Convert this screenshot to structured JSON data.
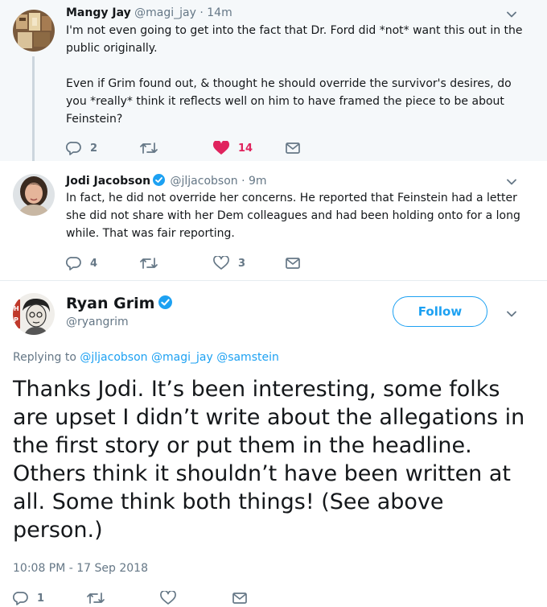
{
  "reply1": {
    "name": "Mangy Jay",
    "handle": "@magi_jay",
    "time": "· 14m",
    "paragraphs": [
      "I'm not even going to get into the fact that Dr. Ford did *not* want this out in the public originally.",
      "Even if Grim found out, & thought he should override the survivor's desires, do you *really* think it reflects well on him to have framed the piece to be about Feinstein?"
    ],
    "replies": "2",
    "retweets": "",
    "likes": "14",
    "liked": true
  },
  "reply2": {
    "name": "Jodi Jacobson",
    "verified": true,
    "handle": "@jljacobson",
    "time": "· 9m",
    "text": "In fact, he did not override her concerns. He reported that Feinstein had a letter she did not share with her Dem colleagues and had been holding onto for a long while. That was fair reporting.",
    "replies": "4",
    "retweets": "",
    "likes": "3"
  },
  "main": {
    "name": "Ryan Grim",
    "verified": true,
    "handle": "@ryangrim",
    "follow_label": "Follow",
    "replying_prefix": "Replying to",
    "mentions": [
      "@jljacobson",
      "@magi_jay",
      "@samstein"
    ],
    "text": "Thanks Jodi. It’s been interesting, some folks are upset I didn’t write about the allegations in the first story or put them in the headline. Others think it shouldn’t have been written at all. Some think both things! (See above person.)",
    "timestamp": "10:08 PM - 17 Sep 2018",
    "replies": "1"
  },
  "colors": {
    "accent": "#1da1f2",
    "like": "#e0245e",
    "muted": "#657786",
    "thread_bg": "#f5f8fa"
  },
  "icons": [
    "reply-icon",
    "retweet-icon",
    "heart-icon",
    "message-icon",
    "chevron-down-icon",
    "verified-badge-icon"
  ]
}
